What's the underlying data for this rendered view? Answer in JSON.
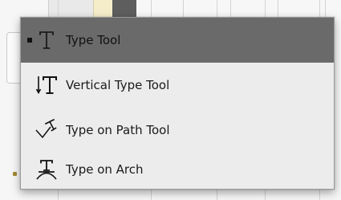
{
  "flyout_menu": {
    "items": [
      {
        "label": "Type Tool",
        "icon": "type-tool-icon",
        "selected": true
      },
      {
        "label": "Vertical Type Tool",
        "icon": "vertical-type-tool-icon",
        "selected": false
      },
      {
        "label": "Type on Path Tool",
        "icon": "type-on-path-tool-icon",
        "selected": false
      },
      {
        "label": "Type on Arch",
        "icon": "type-on-arch-icon",
        "selected": false
      }
    ]
  },
  "colors": {
    "menu_background": "#ececec",
    "highlight": "#6a6a6a",
    "text": "#1a1a1a"
  }
}
